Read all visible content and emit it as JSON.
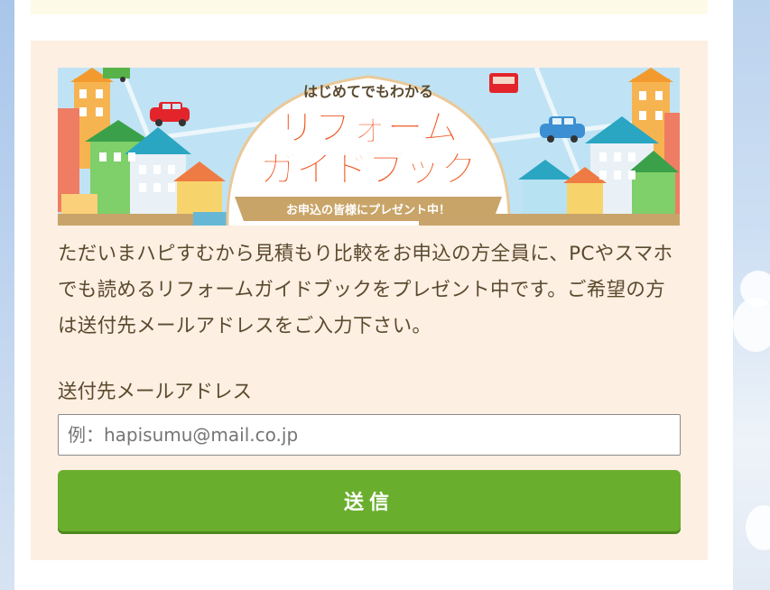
{
  "banner": {
    "subtitle": "はじめてでもわかる",
    "title_line1": "リフォーム",
    "title_line2": "ガイドブック",
    "ribbon": "お申込の皆様にプレゼント中！"
  },
  "description": "ただいまハピすむから見積もり比較をお申込の方全員に、PCやスマホでも読めるリフォームガイドブックをプレゼント中です。ご希望の方は送付先メールアドレスをご入力下さい。",
  "form": {
    "email_label": "送付先メールアドレス",
    "email_value": "",
    "email_placeholder": "例：hapisumu@mail.co.jp",
    "submit_label": "送信"
  },
  "colors": {
    "card_background": "#fdefe2",
    "submit_button": "#6aae2d",
    "title_orange": "#f0521a",
    "text_brown": "#5a4a2e"
  }
}
